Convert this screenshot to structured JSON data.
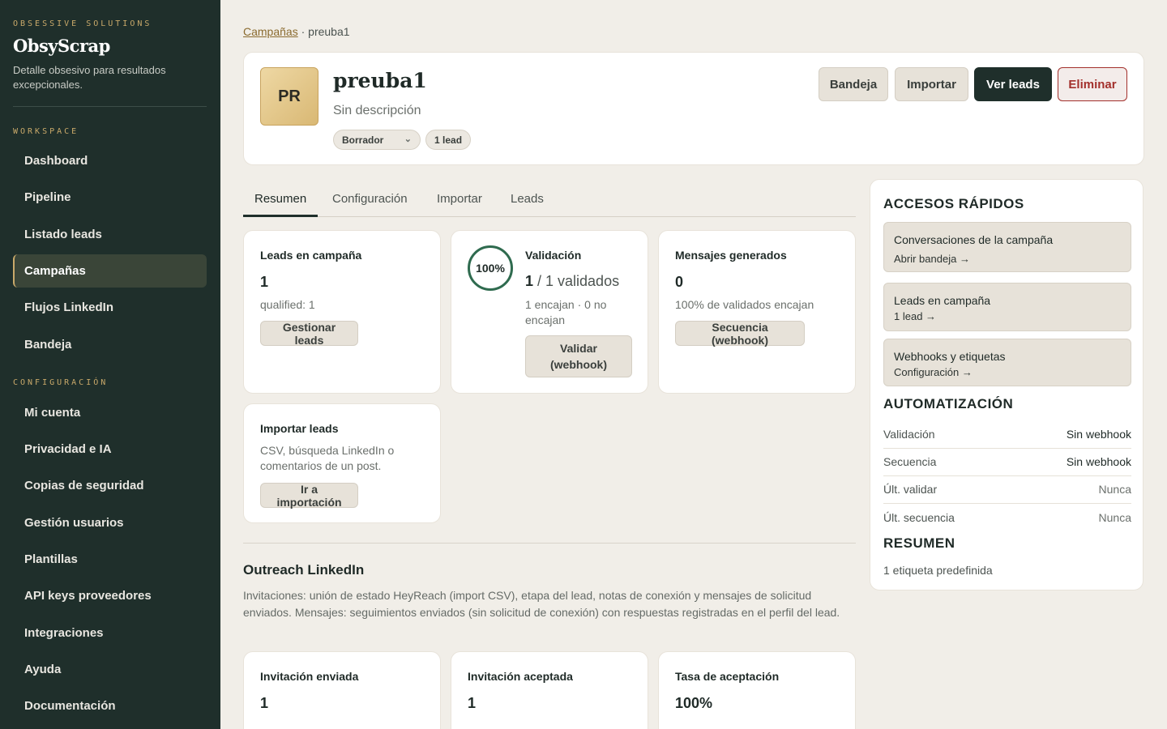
{
  "sidebar": {
    "kicker": "OBSESSIVE SOLUTIONS",
    "brand": "ObsyScrap",
    "tagline": "Detalle obsesivo para resultados excepcionales.",
    "workspace_title": "WORKSPACE",
    "workspace_items": [
      {
        "label": "Dashboard"
      },
      {
        "label": "Pipeline"
      },
      {
        "label": "Listado leads"
      },
      {
        "label": "Campañas",
        "active": true
      },
      {
        "label": "Flujos LinkedIn"
      },
      {
        "label": "Bandeja"
      }
    ],
    "config_title": "CONFIGURACIÓN",
    "config_items": [
      {
        "label": "Mi cuenta"
      },
      {
        "label": "Privacidad e IA"
      },
      {
        "label": "Copias de seguridad"
      },
      {
        "label": "Gestión usuarios"
      },
      {
        "label": "Plantillas"
      },
      {
        "label": "API keys proveedores"
      },
      {
        "label": "Integraciones"
      },
      {
        "label": "Ayuda"
      },
      {
        "label": "Documentación"
      }
    ]
  },
  "breadcrumb": {
    "parent": "Campañas",
    "separator": " · ",
    "current": "preuba1"
  },
  "campaign": {
    "avatar_initials": "PR",
    "title": "preuba1",
    "description": "Sin descripción",
    "status": "Borrador",
    "lead_count": "1 lead"
  },
  "header_actions": {
    "inbox": "Bandeja",
    "import": "Importar",
    "view_leads": "Ver leads",
    "delete": "Eliminar"
  },
  "tabs": [
    {
      "label": "Resumen",
      "active": true
    },
    {
      "label": "Configuración"
    },
    {
      "label": "Importar"
    },
    {
      "label": "Leads"
    }
  ],
  "stats": {
    "leads": {
      "title": "Leads en campaña",
      "value": "1",
      "sub": "qualified: 1",
      "button": "Gestionar leads"
    },
    "validation": {
      "title": "Validación",
      "percent_label": "100%",
      "percent": 100,
      "value": "1",
      "value_suffix": " / 1 validados",
      "sub": "1 encajan · 0 no encajan",
      "button": "Validar (webhook)"
    },
    "messages": {
      "title": "Mensajes generados",
      "value": "0",
      "sub": "100% de validados encajan",
      "button": "Secuencia (webhook)"
    },
    "import": {
      "title": "Importar leads",
      "sub": "CSV, búsqueda LinkedIn o comentarios de un post.",
      "button": "Ir a importación"
    }
  },
  "outreach": {
    "title": "Outreach LinkedIn",
    "description": "Invitaciones: unión de estado HeyReach (import CSV), etapa del lead, notas de conexión y mensajes de solicitud enviados. Mensajes: seguimientos enviados (sin solicitud de conexión) con respuestas registradas en el perfil del lead.",
    "cards": [
      {
        "title": "Invitación enviada",
        "value": "1"
      },
      {
        "title": "Invitación aceptada",
        "value": "1"
      },
      {
        "title": "Tasa de aceptación",
        "value": "100%"
      }
    ]
  },
  "right_panel": {
    "quick_title": "ACCESOS RÁPIDOS",
    "quick_links": [
      {
        "title": "Conversaciones de la campaña",
        "sub": "Abrir bandeja →"
      },
      {
        "title": "Leads en campaña",
        "sub": "1 lead →"
      },
      {
        "title": "Webhooks y etiquetas",
        "sub": "Configuración →"
      }
    ],
    "automation_title": "AUTOMATIZACIÓN",
    "automation": [
      {
        "key": "Validación",
        "value": "Sin webhook"
      },
      {
        "key": "Secuencia",
        "value": "Sin webhook"
      },
      {
        "key": "Últ. validar",
        "value": "Nunca"
      },
      {
        "key": "Últ. secuencia",
        "value": "Nunca"
      }
    ],
    "summary_title": "RESUMEN",
    "summary_text": "1 etiqueta predefinida"
  },
  "colors": {
    "sidebar_bg": "#1f2f2b",
    "accent_gold": "#c9a96a",
    "primary_dark": "#1f2f2b",
    "danger": "#a3302c",
    "ring_green": "#2f6b4f"
  }
}
